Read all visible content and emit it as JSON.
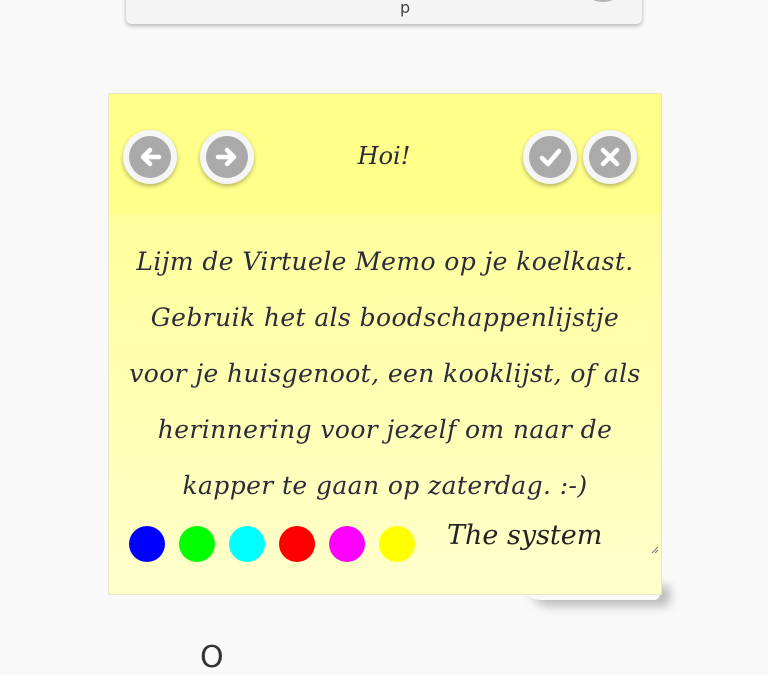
{
  "topCard": {
    "text": "p"
  },
  "memo": {
    "title": "Hoi!",
    "lines": [
      "Lijm de Virtuele Memo op je koelkast.",
      "Gebruik het als boodschappenlijstje",
      "voor je huisgenoot, een kooklijst, of als",
      "herinnering voor jezelf om naar de",
      "kapper te gaan op zaterdag. :-)"
    ],
    "signature": "The system",
    "colors": [
      "#0000ff",
      "#00ff00",
      "#00ffff",
      "#ff0000",
      "#ff00ff",
      "#ffff00"
    ],
    "buttons": {
      "prev": "arrow-left-icon",
      "next": "arrow-right-icon",
      "confirm": "check-icon",
      "close": "close-icon"
    }
  },
  "bottomText": "O"
}
